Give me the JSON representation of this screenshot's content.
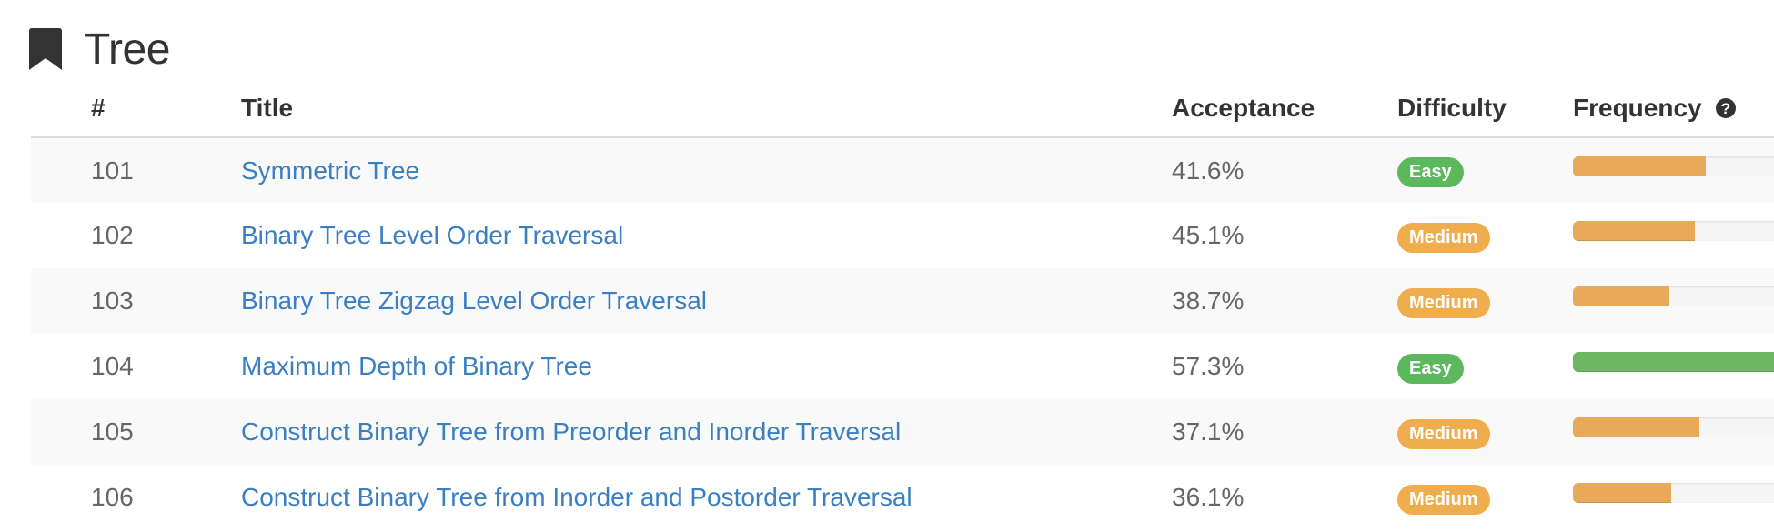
{
  "tag": {
    "title": "Tree",
    "icon": "bookmark-icon"
  },
  "table": {
    "headers": {
      "num": "#",
      "title": "Title",
      "acceptance": "Acceptance",
      "difficulty": "Difficulty",
      "frequency": "Frequency",
      "frequency_icon": "question-circle-icon"
    },
    "rows": [
      {
        "num": "101",
        "title": "Symmetric Tree",
        "acceptance": "41.6%",
        "difficulty": "Easy",
        "frequency": 0.58
      },
      {
        "num": "102",
        "title": "Binary Tree Level Order Traversal",
        "acceptance": "45.1%",
        "difficulty": "Medium",
        "frequency": 0.53
      },
      {
        "num": "103",
        "title": "Binary Tree Zigzag Level Order Traversal",
        "acceptance": "38.7%",
        "difficulty": "Medium",
        "frequency": 0.42
      },
      {
        "num": "104",
        "title": "Maximum Depth of Binary Tree",
        "acceptance": "57.3%",
        "difficulty": "Easy",
        "frequency": 1.0
      },
      {
        "num": "105",
        "title": "Construct Binary Tree from Preorder and Inorder Traversal",
        "acceptance": "37.1%",
        "difficulty": "Medium",
        "frequency": 0.55
      },
      {
        "num": "106",
        "title": "Construct Binary Tree from Inorder and Postorder Traversal",
        "acceptance": "36.1%",
        "difficulty": "Medium",
        "frequency": 0.43
      }
    ]
  },
  "colors": {
    "easy": "#5cb85c",
    "medium": "#f0ad4e",
    "link": "#3a7fc1",
    "freq_orange": "#e8aa58",
    "freq_green": "#6eb564"
  }
}
